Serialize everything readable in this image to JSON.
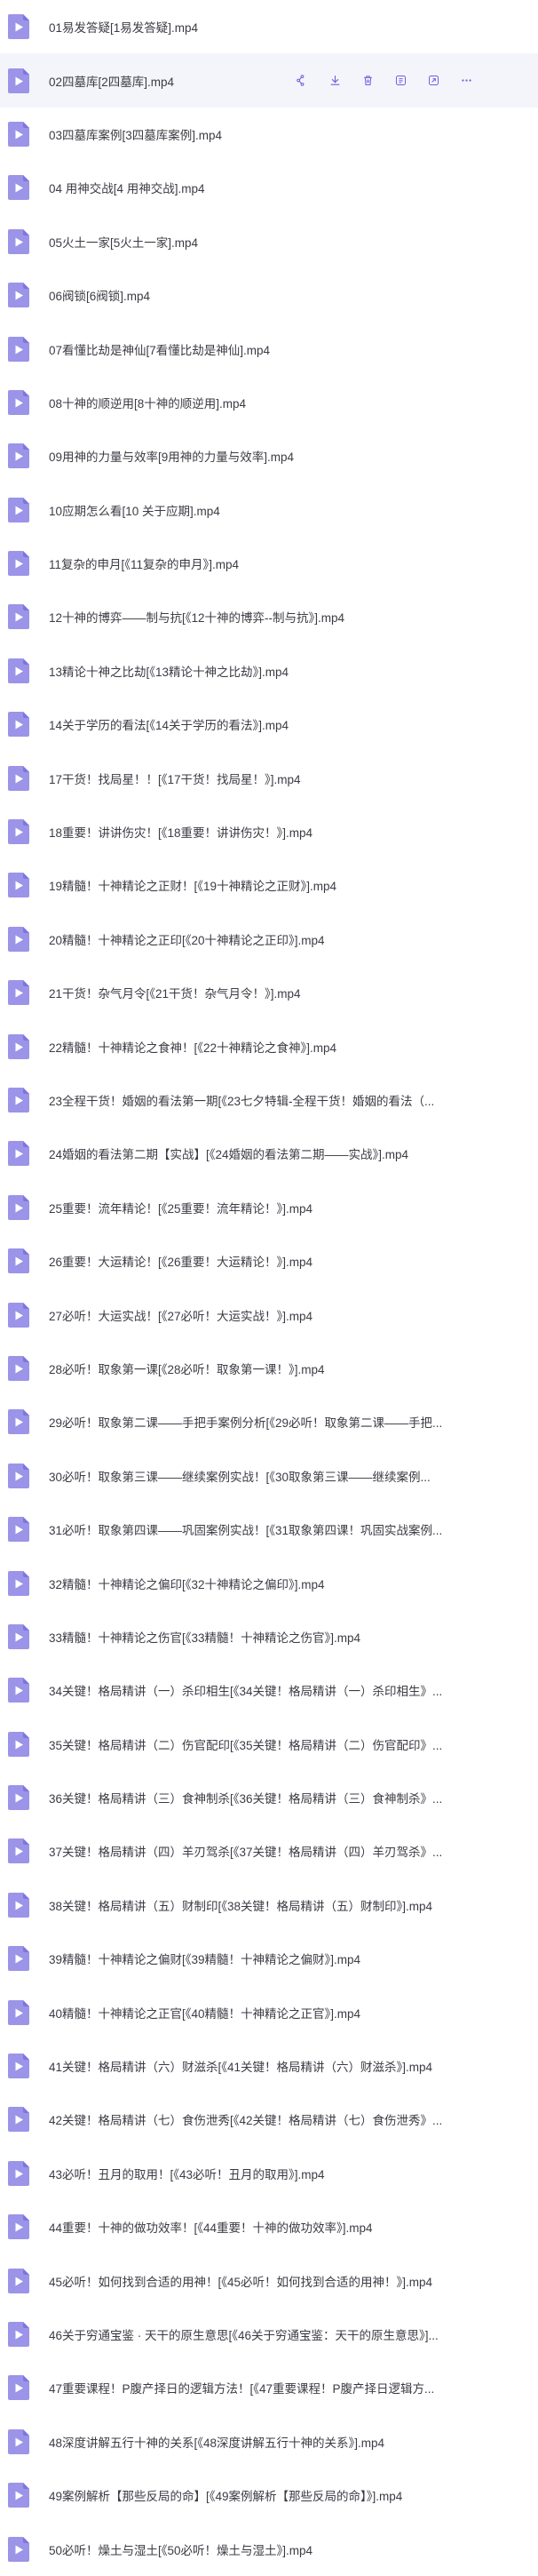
{
  "colors": {
    "icon": "#9b94e8",
    "icon_fold": "#7d75e0",
    "play": "#ffffff",
    "action": "#6a62e0",
    "hover_row": "#f4f5fb"
  },
  "hover_row_index": 1,
  "row_actions": [
    "share-icon",
    "download-icon",
    "delete-icon",
    "info-icon",
    "open-icon",
    "more-icon"
  ],
  "files": [
    "01易发答疑[1易发答疑].mp4",
    "02四墓库[2四墓库].mp4",
    "03四墓库案例[3四墓库案例].mp4",
    "04 用神交战[4 用神交战].mp4",
    "05火土一家[5火土一家].mp4",
    "06阀锁[6阀锁].mp4",
    "07看懂比劫是神仙[7看懂比劫是神仙].mp4",
    "08十神的顺逆用[8十神的顺逆用].mp4",
    "09用神的力量与效率[9用神的力量与效率].mp4",
    "10应期怎么看[10 关于应期].mp4",
    "11复杂的申月[《11复杂的申月》].mp4",
    "12十神的博弈——制与抗[《12十神的博弈--制与抗》].mp4",
    "13精论十神之比劫[《13精论十神之比劫》].mp4",
    "14关于学历的看法[《14关于学历的看法》].mp4",
    "17干货！找局星！！[《17干货！找局星！》].mp4",
    "18重要！讲讲伤灾！[《18重要！讲讲伤灾！》].mp4",
    "19精髓！十神精论之正财！[《19十神精论之正财》].mp4",
    "20精髓！十神精论之正印[《20十神精论之正印》].mp4",
    "21干货！杂气月令[《21干货！杂气月令！》].mp4",
    "22精髓！十神精论之食神！[《22十神精论之食神》].mp4",
    "23全程干货！婚姻的看法第一期[《23七夕特辑-全程干货！婚姻的看法（...",
    "24婚姻的看法第二期【实战】[《24婚姻的看法第二期——实战》].mp4",
    "25重要！流年精论！[《25重要！流年精论！》].mp4",
    "26重要！大运精论！[《26重要！大运精论！》].mp4",
    "27必听！大运实战！[《27必听！大运实战！》].mp4",
    "28必听！取象第一课[《28必听！取象第一课！》].mp4",
    "29必听！取象第二课——手把手案例分析[《29必听！取象第二课——手把...",
    "30必听！取象第三课——继续案例实战！[《30取象第三课——继续案例...",
    "31必听！取象第四课——巩固案例实战！[《31取象第四课！巩固实战案例...",
    "32精髓！十神精论之偏印[《32十神精论之偏印》].mp4",
    "33精髓！十神精论之伤官[《33精髓！十神精论之伤官》].mp4",
    "34关键！格局精讲（一）杀印相生[《34关键！格局精讲（一）杀印相生》...",
    "35关键！格局精讲（二）伤官配印[《35关键！格局精讲（二）伤官配印》...",
    "36关键！格局精讲（三）食神制杀[《36关键！格局精讲（三）食神制杀》...",
    "37关键！格局精讲（四）羊刃驾杀[《37关键！格局精讲（四）羊刃驾杀》...",
    "38关键！格局精讲（五）财制印[《38关键！格局精讲（五）财制印》].mp4",
    "39精髓！十神精论之偏财[《39精髓！十神精论之偏财》].mp4",
    "40精髓！十神精论之正官[《40精髓！十神精论之正官》].mp4",
    "41关键！格局精讲（六）财滋杀[《41关键！格局精讲（六）财滋杀》].mp4",
    "42关键！格局精讲（七）食伤泄秀[《42关键！格局精讲（七）食伤泄秀》...",
    "43必听！丑月的取用！[《43必听！丑月的取用》].mp4",
    "44重要！十神的做功效率！[《44重要！十神的做功效率》].mp4",
    "45必听！如何找到合适的用神！[《45必听！如何找到合适的用神！》].mp4",
    "46关于穷通宝鉴 · 天干的原生意思[《46关于穷通宝鉴：天干的原生意思》]...",
    "47重要课程！P腹产择日的逻辑方法！[《47重要课程！P腹产择日逻辑方...",
    "48深度讲解五行十神的关系[《48深度讲解五行十神的关系》].mp4",
    "49案例解析【那些反局的命】[《49案例解析【那些反局的命】》].mp4",
    "50必听！燥土与湿土[《50必听！燥土与湿土》].mp4"
  ]
}
